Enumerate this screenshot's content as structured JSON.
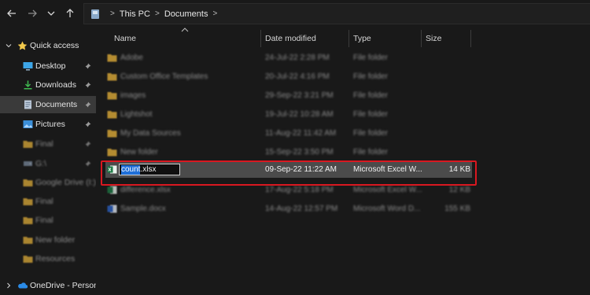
{
  "address": {
    "segments": [
      "This PC",
      "Documents"
    ]
  },
  "sidebar": {
    "quick_access": "Quick access",
    "items": [
      {
        "label": "Desktop",
        "icon": "desktop-icon"
      },
      {
        "label": "Downloads",
        "icon": "download-icon"
      },
      {
        "label": "Documents",
        "icon": "documents-icon",
        "selected": true
      },
      {
        "label": "Pictures",
        "icon": "pictures-icon"
      },
      {
        "label": "Final",
        "icon": "folder-icon"
      },
      {
        "label": "G:\\",
        "icon": "drive-icon"
      },
      {
        "label": "Google Drive (I:)",
        "icon": "folder-icon"
      },
      {
        "label": "Final",
        "icon": "folder-icon"
      },
      {
        "label": "Final",
        "icon": "folder-icon"
      },
      {
        "label": "New folder",
        "icon": "folder-icon"
      },
      {
        "label": "Resources",
        "icon": "folder-icon"
      }
    ],
    "onedrive": "OneDrive - Personal"
  },
  "columns": {
    "name": "Name",
    "date": "Date modified",
    "type": "Type",
    "size": "Size"
  },
  "files": [
    {
      "name": "Adobe",
      "date": "24-Jul-22 2:28 PM",
      "type": "File folder",
      "size": ""
    },
    {
      "name": "Custom Office Templates",
      "date": "20-Jul-22 4:16 PM",
      "type": "File folder",
      "size": ""
    },
    {
      "name": "images",
      "date": "29-Sep-22 3:21 PM",
      "type": "File folder",
      "size": ""
    },
    {
      "name": "Lightshot",
      "date": "19-Jul-22 10:28 AM",
      "type": "File folder",
      "size": ""
    },
    {
      "name": "My Data Sources",
      "date": "11-Aug-22 11:42 AM",
      "type": "File folder",
      "size": ""
    },
    {
      "name": "New folder",
      "date": "15-Sep-22 3:50 PM",
      "type": "File folder",
      "size": ""
    }
  ],
  "rename_row": {
    "name_selected": "count",
    "name_ext": ".xlsx",
    "date": "09-Sep-22 11:22 AM",
    "type": "Microsoft Excel W...",
    "size": "14 KB"
  },
  "files_after": [
    {
      "name": "difference.xlsx",
      "date": "17-Aug-22 5:18 PM",
      "type": "Microsoft Excel W...",
      "size": "12 KB",
      "icon": "excel-icon"
    },
    {
      "name": "Sample.docx",
      "date": "14-Aug-22 12:57 PM",
      "type": "Microsoft Word D...",
      "size": "155 KB",
      "icon": "word-icon"
    }
  ],
  "colors": {
    "folder": "#e8b33a",
    "selection": "#1f6fd8",
    "highlight": "#d91820",
    "excel": "#1d7a45",
    "word": "#2b63c9"
  }
}
